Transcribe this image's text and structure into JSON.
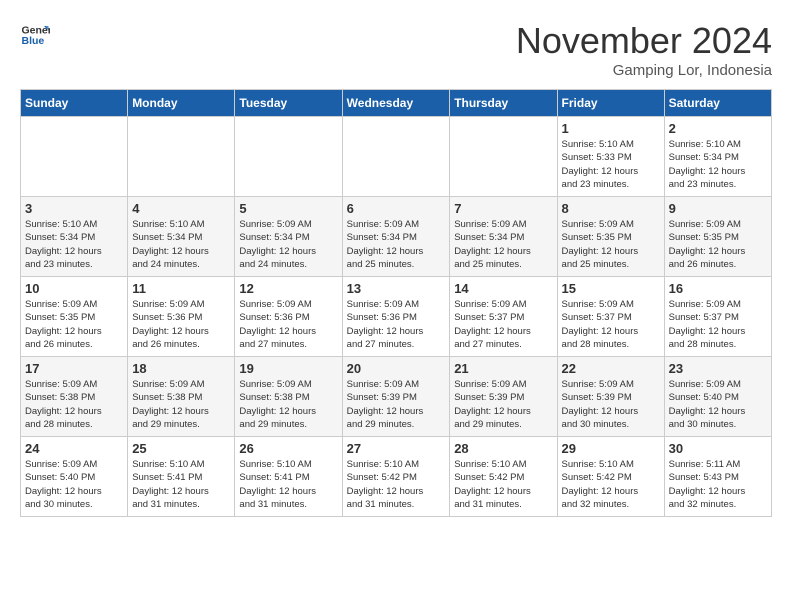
{
  "header": {
    "logo_line1": "General",
    "logo_line2": "Blue",
    "month_title": "November 2024",
    "location": "Gamping Lor, Indonesia"
  },
  "weekdays": [
    "Sunday",
    "Monday",
    "Tuesday",
    "Wednesday",
    "Thursday",
    "Friday",
    "Saturday"
  ],
  "weeks": [
    [
      {
        "day": "",
        "info": ""
      },
      {
        "day": "",
        "info": ""
      },
      {
        "day": "",
        "info": ""
      },
      {
        "day": "",
        "info": ""
      },
      {
        "day": "",
        "info": ""
      },
      {
        "day": "1",
        "info": "Sunrise: 5:10 AM\nSunset: 5:33 PM\nDaylight: 12 hours\nand 23 minutes."
      },
      {
        "day": "2",
        "info": "Sunrise: 5:10 AM\nSunset: 5:34 PM\nDaylight: 12 hours\nand 23 minutes."
      }
    ],
    [
      {
        "day": "3",
        "info": "Sunrise: 5:10 AM\nSunset: 5:34 PM\nDaylight: 12 hours\nand 23 minutes."
      },
      {
        "day": "4",
        "info": "Sunrise: 5:10 AM\nSunset: 5:34 PM\nDaylight: 12 hours\nand 24 minutes."
      },
      {
        "day": "5",
        "info": "Sunrise: 5:09 AM\nSunset: 5:34 PM\nDaylight: 12 hours\nand 24 minutes."
      },
      {
        "day": "6",
        "info": "Sunrise: 5:09 AM\nSunset: 5:34 PM\nDaylight: 12 hours\nand 25 minutes."
      },
      {
        "day": "7",
        "info": "Sunrise: 5:09 AM\nSunset: 5:34 PM\nDaylight: 12 hours\nand 25 minutes."
      },
      {
        "day": "8",
        "info": "Sunrise: 5:09 AM\nSunset: 5:35 PM\nDaylight: 12 hours\nand 25 minutes."
      },
      {
        "day": "9",
        "info": "Sunrise: 5:09 AM\nSunset: 5:35 PM\nDaylight: 12 hours\nand 26 minutes."
      }
    ],
    [
      {
        "day": "10",
        "info": "Sunrise: 5:09 AM\nSunset: 5:35 PM\nDaylight: 12 hours\nand 26 minutes."
      },
      {
        "day": "11",
        "info": "Sunrise: 5:09 AM\nSunset: 5:36 PM\nDaylight: 12 hours\nand 26 minutes."
      },
      {
        "day": "12",
        "info": "Sunrise: 5:09 AM\nSunset: 5:36 PM\nDaylight: 12 hours\nand 27 minutes."
      },
      {
        "day": "13",
        "info": "Sunrise: 5:09 AM\nSunset: 5:36 PM\nDaylight: 12 hours\nand 27 minutes."
      },
      {
        "day": "14",
        "info": "Sunrise: 5:09 AM\nSunset: 5:37 PM\nDaylight: 12 hours\nand 27 minutes."
      },
      {
        "day": "15",
        "info": "Sunrise: 5:09 AM\nSunset: 5:37 PM\nDaylight: 12 hours\nand 28 minutes."
      },
      {
        "day": "16",
        "info": "Sunrise: 5:09 AM\nSunset: 5:37 PM\nDaylight: 12 hours\nand 28 minutes."
      }
    ],
    [
      {
        "day": "17",
        "info": "Sunrise: 5:09 AM\nSunset: 5:38 PM\nDaylight: 12 hours\nand 28 minutes."
      },
      {
        "day": "18",
        "info": "Sunrise: 5:09 AM\nSunset: 5:38 PM\nDaylight: 12 hours\nand 29 minutes."
      },
      {
        "day": "19",
        "info": "Sunrise: 5:09 AM\nSunset: 5:38 PM\nDaylight: 12 hours\nand 29 minutes."
      },
      {
        "day": "20",
        "info": "Sunrise: 5:09 AM\nSunset: 5:39 PM\nDaylight: 12 hours\nand 29 minutes."
      },
      {
        "day": "21",
        "info": "Sunrise: 5:09 AM\nSunset: 5:39 PM\nDaylight: 12 hours\nand 29 minutes."
      },
      {
        "day": "22",
        "info": "Sunrise: 5:09 AM\nSunset: 5:39 PM\nDaylight: 12 hours\nand 30 minutes."
      },
      {
        "day": "23",
        "info": "Sunrise: 5:09 AM\nSunset: 5:40 PM\nDaylight: 12 hours\nand 30 minutes."
      }
    ],
    [
      {
        "day": "24",
        "info": "Sunrise: 5:09 AM\nSunset: 5:40 PM\nDaylight: 12 hours\nand 30 minutes."
      },
      {
        "day": "25",
        "info": "Sunrise: 5:10 AM\nSunset: 5:41 PM\nDaylight: 12 hours\nand 31 minutes."
      },
      {
        "day": "26",
        "info": "Sunrise: 5:10 AM\nSunset: 5:41 PM\nDaylight: 12 hours\nand 31 minutes."
      },
      {
        "day": "27",
        "info": "Sunrise: 5:10 AM\nSunset: 5:42 PM\nDaylight: 12 hours\nand 31 minutes."
      },
      {
        "day": "28",
        "info": "Sunrise: 5:10 AM\nSunset: 5:42 PM\nDaylight: 12 hours\nand 31 minutes."
      },
      {
        "day": "29",
        "info": "Sunrise: 5:10 AM\nSunset: 5:42 PM\nDaylight: 12 hours\nand 32 minutes."
      },
      {
        "day": "30",
        "info": "Sunrise: 5:11 AM\nSunset: 5:43 PM\nDaylight: 12 hours\nand 32 minutes."
      }
    ]
  ]
}
